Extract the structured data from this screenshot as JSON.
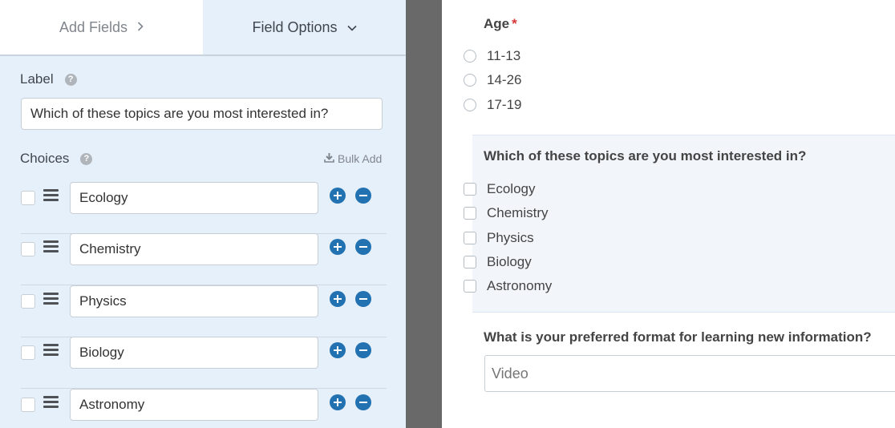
{
  "tabs": {
    "add_fields": "Add Fields",
    "field_options": "Field Options"
  },
  "field_options": {
    "label_heading": "Label",
    "label_value": "Which of these topics are you most interested in?",
    "choices_heading": "Choices",
    "bulk_add": "Bulk Add",
    "choices": [
      {
        "label": "Ecology",
        "checked": false
      },
      {
        "label": "Chemistry",
        "checked": false
      },
      {
        "label": "Physics",
        "checked": false
      },
      {
        "label": "Biology",
        "checked": false
      },
      {
        "label": "Astronomy",
        "checked": false
      }
    ]
  },
  "preview": {
    "age": {
      "title": "Age",
      "required_marker": "*",
      "options": [
        "11-13",
        "14-26",
        "17-19"
      ]
    },
    "topics": {
      "title": "Which of these topics are you most interested in?",
      "options": [
        "Ecology",
        "Chemistry",
        "Physics",
        "Biology",
        "Astronomy"
      ]
    },
    "format": {
      "title": "What is your preferred format for learning new information?",
      "placeholder": "Video"
    }
  },
  "colors": {
    "panel_bg": "#e6f0fb",
    "accent_blue": "#2271b1",
    "required_red": "#d63638",
    "divider_gray": "#696969"
  },
  "icons": [
    "chevron-right-icon",
    "chevron-down-icon",
    "help-icon",
    "download-icon",
    "drag-handle-icon",
    "plus-circle-icon",
    "minus-circle-icon"
  ]
}
